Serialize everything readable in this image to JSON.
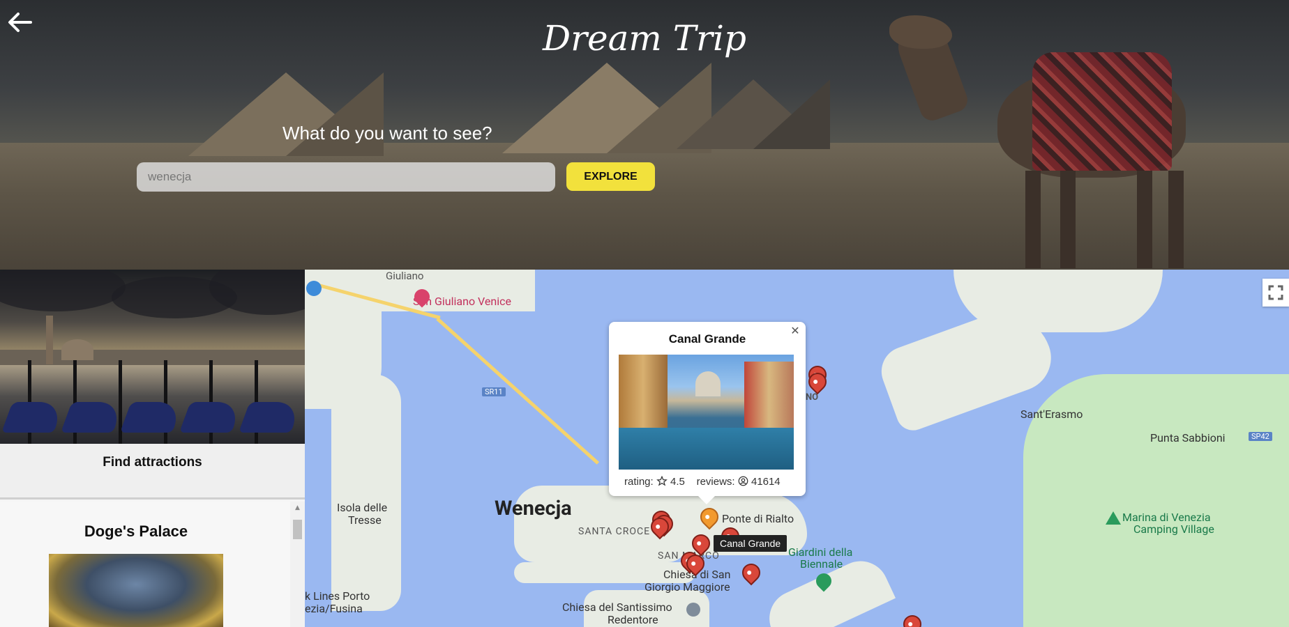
{
  "app": {
    "title": "Dream Trip"
  },
  "hero": {
    "question": "What do you want to see?",
    "search_value": "wenecja",
    "explore_label": "EXPLORE"
  },
  "sidebar": {
    "find_attractions_label": "Find attractions",
    "attractions": [
      {
        "title": "Doge's Palace"
      }
    ]
  },
  "map": {
    "labels": {
      "giuliano": "Giuliano",
      "san_giuliano": "San Giuliano Venice",
      "sr11": "SR11",
      "sant_erasmo": "Sant'Erasmo",
      "punta_sabbioni": "Punta Sabbioni",
      "sp42": "SP42",
      "isola_delle": "Isola delle",
      "tresse": "Tresse",
      "wenecja": "Wenecja",
      "santa_croce": "SANTA CROCE",
      "ponte_rialto": "Ponte di Rialto",
      "san_marco": "SAN MARCO",
      "giardini": "Giardini della",
      "biennale": "Biennale",
      "marina": "Marina di Venezia",
      "camping": "Camping Village",
      "chiesa_di_san": "Chiesa di San",
      "giorgio": "Giorgio Maggiore",
      "chiesa_santissimo": "Chiesa del Santissimo",
      "redentore": "Redentore",
      "lines_porto": "k Lines Porto",
      "ezia_fusina": "ezia/Fusina",
      "no": "NO"
    },
    "popup": {
      "title": "Canal Grande",
      "rating_label": "rating:",
      "rating_value": "4.5",
      "reviews_label": "reviews:",
      "reviews_value": "41614"
    },
    "tooltip": "Canal Grande"
  }
}
